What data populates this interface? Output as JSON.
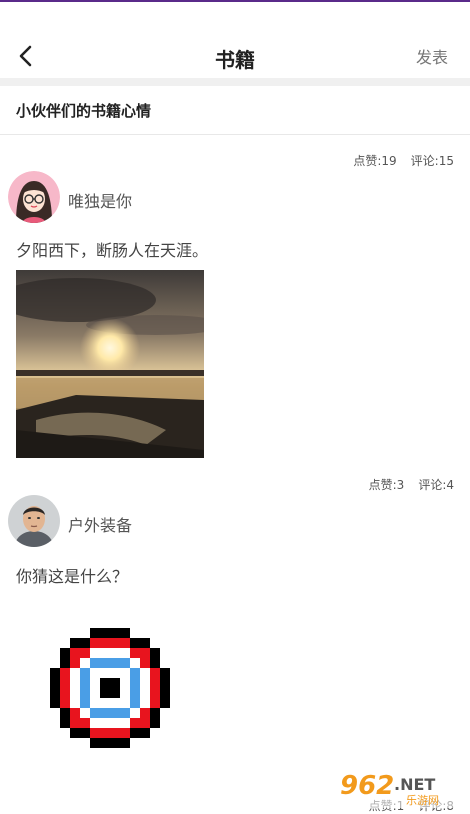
{
  "header": {
    "title": "书籍",
    "publish_label": "发表"
  },
  "section": {
    "title": "小伙伴们的书籍心情"
  },
  "posts": [
    {
      "likes": "点赞:19",
      "comments": "评论:15",
      "username": "唯独是你",
      "content": "夕阳西下，断肠人在天涯。"
    },
    {
      "likes": "点赞:3",
      "comments": "评论:4",
      "username": "户外装备",
      "content": "你猜这是什么？"
    },
    {
      "likes": "点赞:1",
      "comments": "评论:8"
    }
  ],
  "watermark": {
    "number": "962",
    "suffix": ".NET",
    "sub": "乐游网"
  }
}
